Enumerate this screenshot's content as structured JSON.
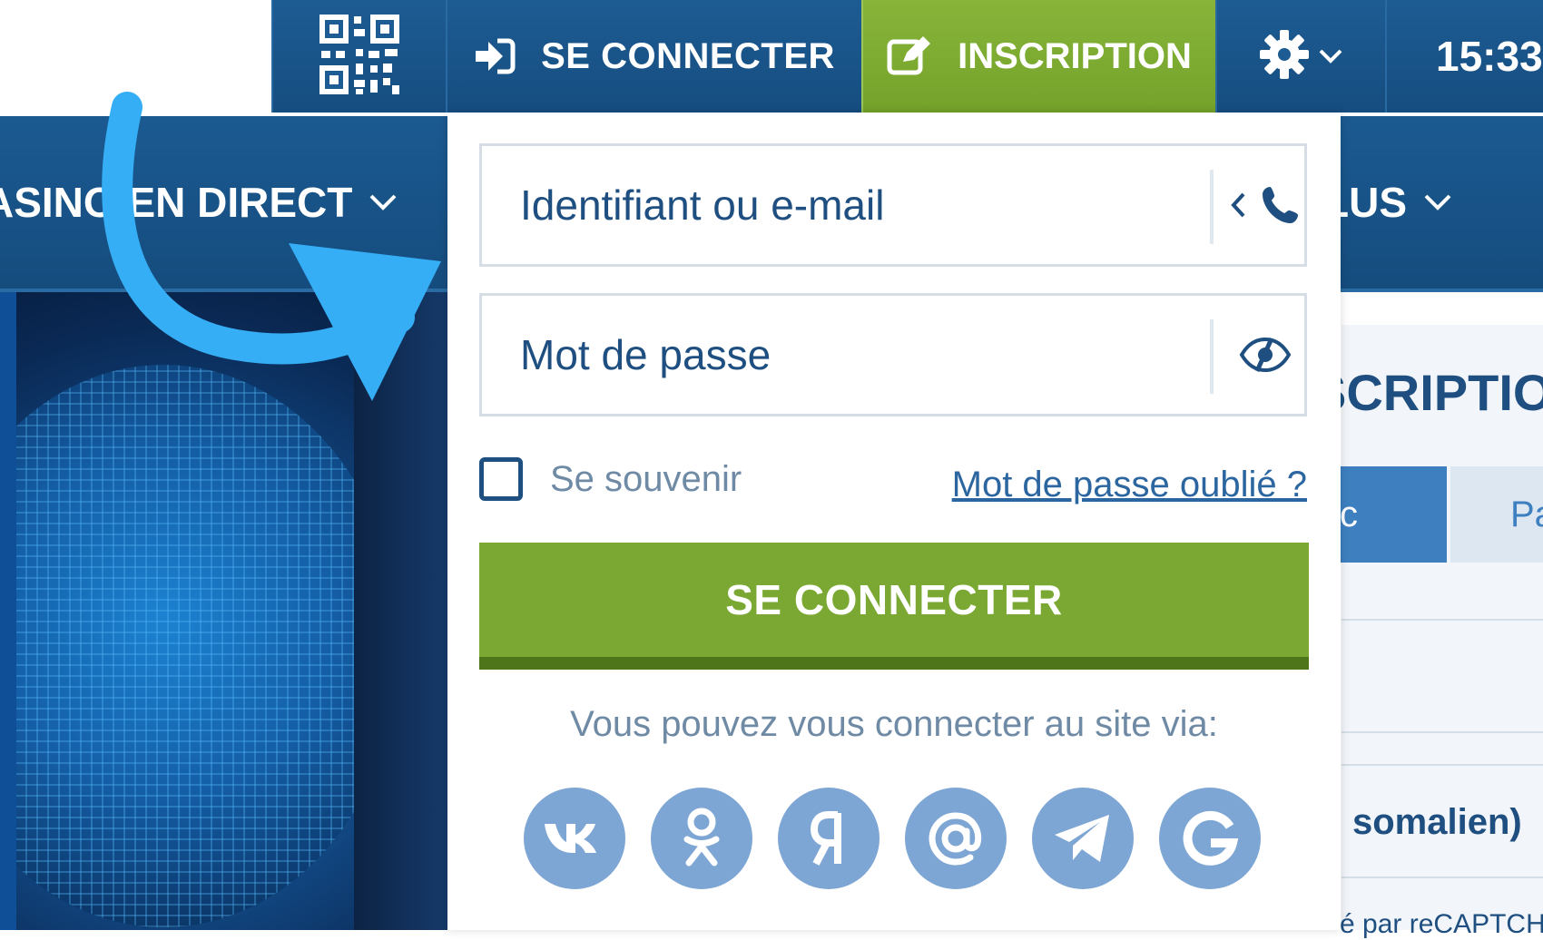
{
  "topbar": {
    "qr_icon": "qr-code-icon",
    "login_label": "SE CONNECTER",
    "register_label": "INSCRIPTION",
    "time": "15:33"
  },
  "nav": {
    "casino_label": "ASINO EN DIRECT",
    "plus_label": "LUS"
  },
  "login": {
    "username_placeholder": "Identifiant ou e-mail",
    "password_placeholder": "Mot de passe",
    "remember_label": "Se souvenir",
    "forgot_label": "Mot de passe oublié ?",
    "submit_label": "SE CONNECTER",
    "via_label": "Vous pouvez vous connecter au site via:",
    "socials": [
      "vk-icon",
      "odnoklassniki-icon",
      "yandex-icon",
      "mail-at-icon",
      "telegram-icon",
      "google-icon"
    ]
  },
  "registration": {
    "title": "SCRIPTIO",
    "tab1": "c",
    "tab2": "Pa",
    "language": "somalien)",
    "captcha": "é par reCAPTCH"
  },
  "colors": {
    "primary_blue": "#1d5c93",
    "accent_green": "#7aa832",
    "social_blue": "#7ea6d4",
    "arrow_blue": "#35aef5"
  }
}
